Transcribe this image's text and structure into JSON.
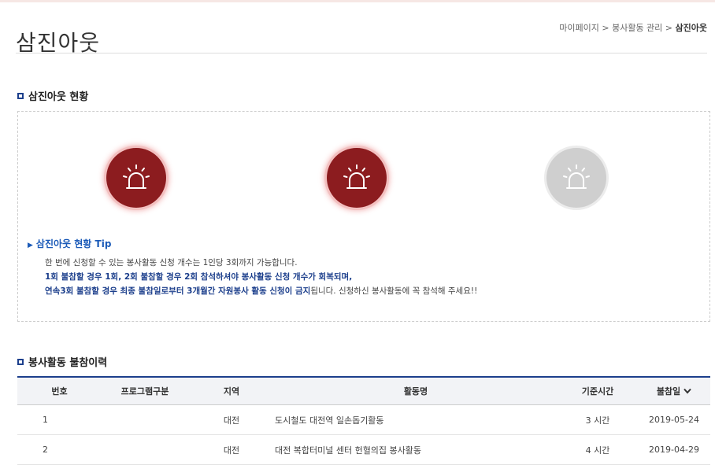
{
  "header": {
    "title": "삼진아웃",
    "breadcrumb": [
      "마이페이지",
      "봉사활동 관리",
      "삼진아웃"
    ],
    "breadcrumb_separator": ">"
  },
  "status_section": {
    "title": "삼진아웃 현황",
    "sirens": [
      {
        "state": "active",
        "icon": "siren-icon"
      },
      {
        "state": "active",
        "icon": "siren-icon"
      },
      {
        "state": "inactive",
        "icon": "siren-icon"
      }
    ],
    "tip_title": "삼진아웃 현황 Tip",
    "tip_line1": "한 번에 신청할 수 있는 봉사활동 신청 개수는 1인당 3회까지 가능합니다.",
    "tip_line2_bold": "1회 불참할 경우 1회, 2회 불참할 경우 2회 참석하셔야 봉사활동 신청 개수가 회복되며,",
    "tip_line3_bold": "연속3회 불참할 경우 최종 불참일로부터 3개월간 자원봉사 활동 신청이 금지",
    "tip_line3_rest": "됩니다. 신청하신 봉사활동에 꼭 참석해 주세요!!"
  },
  "history_section": {
    "title": "봉사활동 불참이력",
    "columns": [
      "번호",
      "프로그램구분",
      "지역",
      "활동명",
      "기준시간",
      "불참일"
    ],
    "rows": [
      {
        "no": "1",
        "program": "",
        "region": "대전",
        "activity": "도시철도 대전역 일손돕기활동",
        "hours": "3 시간",
        "date": "2019-05-24"
      },
      {
        "no": "2",
        "program": "",
        "region": "대전",
        "activity": "대전 복합터미널 센터 헌혈의집 봉사활동",
        "hours": "4 시간",
        "date": "2019-04-29"
      }
    ]
  },
  "colors": {
    "accent": "#1c3f8c",
    "siren_active": "#8c1c1f",
    "siren_inactive": "#cfcfcf",
    "tip": "#1c5bb8"
  }
}
